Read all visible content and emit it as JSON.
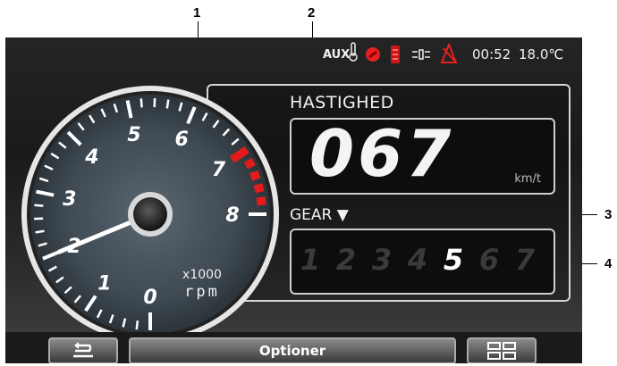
{
  "callouts": [
    "1",
    "2",
    "3",
    "4"
  ],
  "status": {
    "aux": "AUX",
    "clock": "00:52",
    "temperature": "18.0℃"
  },
  "gauge": {
    "scale_labels": [
      "0",
      "1",
      "2",
      "3",
      "4",
      "5",
      "6",
      "7",
      "8"
    ],
    "unit_line1": "x1000",
    "unit_line2": "rpm",
    "rpm_value": 2,
    "redline_from": 7
  },
  "speed": {
    "title": "HASTIGHED",
    "value": "067",
    "unit": "km/t"
  },
  "gear": {
    "title": "GEAR ▼",
    "numbers": [
      "1",
      "2",
      "3",
      "4",
      "5",
      "6",
      "7"
    ],
    "current": 5
  },
  "bottom": {
    "options_label": "Optioner",
    "back_icon": "back-arrow-icon",
    "grid_icon": "grid-menu-icon"
  },
  "colors": {
    "redline": "#e31b1b",
    "status_icon_red": "#e62020"
  }
}
